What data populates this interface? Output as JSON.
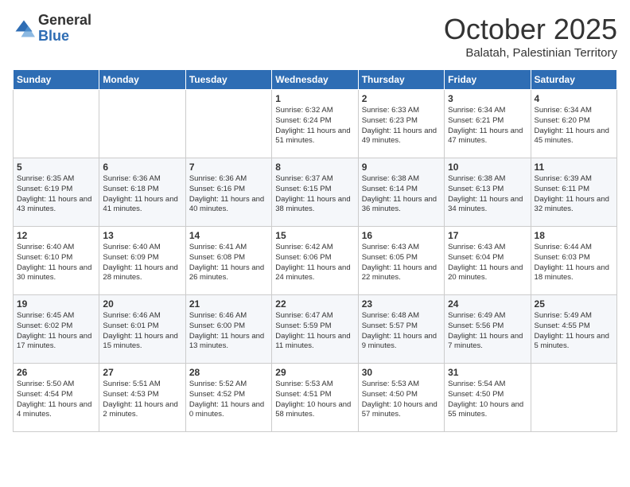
{
  "header": {
    "logo_general": "General",
    "logo_blue": "Blue",
    "month_title": "October 2025",
    "location": "Balatah, Palestinian Territory"
  },
  "weekdays": [
    "Sunday",
    "Monday",
    "Tuesday",
    "Wednesday",
    "Thursday",
    "Friday",
    "Saturday"
  ],
  "weeks": [
    [
      {
        "day": "",
        "sunrise": "",
        "sunset": "",
        "daylight": ""
      },
      {
        "day": "",
        "sunrise": "",
        "sunset": "",
        "daylight": ""
      },
      {
        "day": "",
        "sunrise": "",
        "sunset": "",
        "daylight": ""
      },
      {
        "day": "1",
        "sunrise": "Sunrise: 6:32 AM",
        "sunset": "Sunset: 6:24 PM",
        "daylight": "Daylight: 11 hours and 51 minutes."
      },
      {
        "day": "2",
        "sunrise": "Sunrise: 6:33 AM",
        "sunset": "Sunset: 6:23 PM",
        "daylight": "Daylight: 11 hours and 49 minutes."
      },
      {
        "day": "3",
        "sunrise": "Sunrise: 6:34 AM",
        "sunset": "Sunset: 6:21 PM",
        "daylight": "Daylight: 11 hours and 47 minutes."
      },
      {
        "day": "4",
        "sunrise": "Sunrise: 6:34 AM",
        "sunset": "Sunset: 6:20 PM",
        "daylight": "Daylight: 11 hours and 45 minutes."
      }
    ],
    [
      {
        "day": "5",
        "sunrise": "Sunrise: 6:35 AM",
        "sunset": "Sunset: 6:19 PM",
        "daylight": "Daylight: 11 hours and 43 minutes."
      },
      {
        "day": "6",
        "sunrise": "Sunrise: 6:36 AM",
        "sunset": "Sunset: 6:18 PM",
        "daylight": "Daylight: 11 hours and 41 minutes."
      },
      {
        "day": "7",
        "sunrise": "Sunrise: 6:36 AM",
        "sunset": "Sunset: 6:16 PM",
        "daylight": "Daylight: 11 hours and 40 minutes."
      },
      {
        "day": "8",
        "sunrise": "Sunrise: 6:37 AM",
        "sunset": "Sunset: 6:15 PM",
        "daylight": "Daylight: 11 hours and 38 minutes."
      },
      {
        "day": "9",
        "sunrise": "Sunrise: 6:38 AM",
        "sunset": "Sunset: 6:14 PM",
        "daylight": "Daylight: 11 hours and 36 minutes."
      },
      {
        "day": "10",
        "sunrise": "Sunrise: 6:38 AM",
        "sunset": "Sunset: 6:13 PM",
        "daylight": "Daylight: 11 hours and 34 minutes."
      },
      {
        "day": "11",
        "sunrise": "Sunrise: 6:39 AM",
        "sunset": "Sunset: 6:11 PM",
        "daylight": "Daylight: 11 hours and 32 minutes."
      }
    ],
    [
      {
        "day": "12",
        "sunrise": "Sunrise: 6:40 AM",
        "sunset": "Sunset: 6:10 PM",
        "daylight": "Daylight: 11 hours and 30 minutes."
      },
      {
        "day": "13",
        "sunrise": "Sunrise: 6:40 AM",
        "sunset": "Sunset: 6:09 PM",
        "daylight": "Daylight: 11 hours and 28 minutes."
      },
      {
        "day": "14",
        "sunrise": "Sunrise: 6:41 AM",
        "sunset": "Sunset: 6:08 PM",
        "daylight": "Daylight: 11 hours and 26 minutes."
      },
      {
        "day": "15",
        "sunrise": "Sunrise: 6:42 AM",
        "sunset": "Sunset: 6:06 PM",
        "daylight": "Daylight: 11 hours and 24 minutes."
      },
      {
        "day": "16",
        "sunrise": "Sunrise: 6:43 AM",
        "sunset": "Sunset: 6:05 PM",
        "daylight": "Daylight: 11 hours and 22 minutes."
      },
      {
        "day": "17",
        "sunrise": "Sunrise: 6:43 AM",
        "sunset": "Sunset: 6:04 PM",
        "daylight": "Daylight: 11 hours and 20 minutes."
      },
      {
        "day": "18",
        "sunrise": "Sunrise: 6:44 AM",
        "sunset": "Sunset: 6:03 PM",
        "daylight": "Daylight: 11 hours and 18 minutes."
      }
    ],
    [
      {
        "day": "19",
        "sunrise": "Sunrise: 6:45 AM",
        "sunset": "Sunset: 6:02 PM",
        "daylight": "Daylight: 11 hours and 17 minutes."
      },
      {
        "day": "20",
        "sunrise": "Sunrise: 6:46 AM",
        "sunset": "Sunset: 6:01 PM",
        "daylight": "Daylight: 11 hours and 15 minutes."
      },
      {
        "day": "21",
        "sunrise": "Sunrise: 6:46 AM",
        "sunset": "Sunset: 6:00 PM",
        "daylight": "Daylight: 11 hours and 13 minutes."
      },
      {
        "day": "22",
        "sunrise": "Sunrise: 6:47 AM",
        "sunset": "Sunset: 5:59 PM",
        "daylight": "Daylight: 11 hours and 11 minutes."
      },
      {
        "day": "23",
        "sunrise": "Sunrise: 6:48 AM",
        "sunset": "Sunset: 5:57 PM",
        "daylight": "Daylight: 11 hours and 9 minutes."
      },
      {
        "day": "24",
        "sunrise": "Sunrise: 6:49 AM",
        "sunset": "Sunset: 5:56 PM",
        "daylight": "Daylight: 11 hours and 7 minutes."
      },
      {
        "day": "25",
        "sunrise": "Sunrise: 5:49 AM",
        "sunset": "Sunset: 4:55 PM",
        "daylight": "Daylight: 11 hours and 5 minutes."
      }
    ],
    [
      {
        "day": "26",
        "sunrise": "Sunrise: 5:50 AM",
        "sunset": "Sunset: 4:54 PM",
        "daylight": "Daylight: 11 hours and 4 minutes."
      },
      {
        "day": "27",
        "sunrise": "Sunrise: 5:51 AM",
        "sunset": "Sunset: 4:53 PM",
        "daylight": "Daylight: 11 hours and 2 minutes."
      },
      {
        "day": "28",
        "sunrise": "Sunrise: 5:52 AM",
        "sunset": "Sunset: 4:52 PM",
        "daylight": "Daylight: 11 hours and 0 minutes."
      },
      {
        "day": "29",
        "sunrise": "Sunrise: 5:53 AM",
        "sunset": "Sunset: 4:51 PM",
        "daylight": "Daylight: 10 hours and 58 minutes."
      },
      {
        "day": "30",
        "sunrise": "Sunrise: 5:53 AM",
        "sunset": "Sunset: 4:50 PM",
        "daylight": "Daylight: 10 hours and 57 minutes."
      },
      {
        "day": "31",
        "sunrise": "Sunrise: 5:54 AM",
        "sunset": "Sunset: 4:50 PM",
        "daylight": "Daylight: 10 hours and 55 minutes."
      },
      {
        "day": "",
        "sunrise": "",
        "sunset": "",
        "daylight": ""
      }
    ]
  ]
}
